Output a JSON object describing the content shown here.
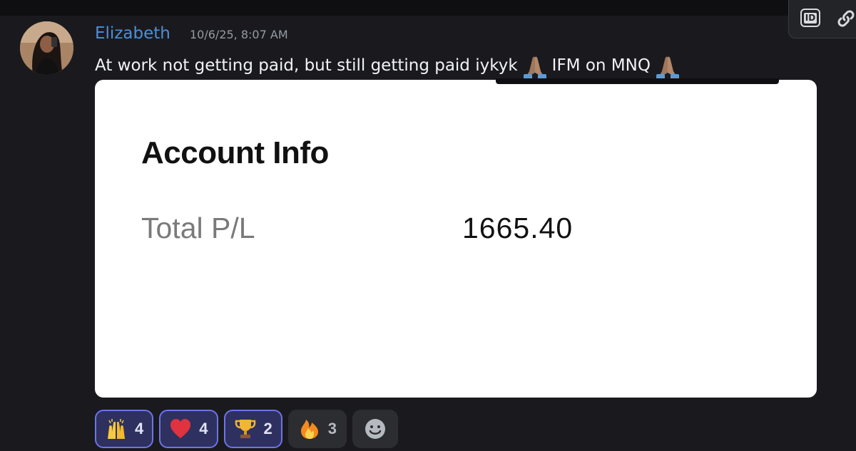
{
  "message": {
    "username": "Elizabeth",
    "timestamp": "10/6/25, 8:07 AM",
    "text_part1": "At work not getting paid, but still getting paid iykyk",
    "text_part2": "IFM on MNQ"
  },
  "embed": {
    "title": "Account Info",
    "pl_label": "Total P/L",
    "pl_value": "1665.40"
  },
  "reactions": [
    {
      "emoji": "raising-hands-icon",
      "count": "4",
      "selected": true
    },
    {
      "emoji": "red-heart-icon",
      "count": "4",
      "selected": true
    },
    {
      "emoji": "trophy-icon",
      "count": "2",
      "selected": true
    },
    {
      "emoji": "fire-icon",
      "count": "3",
      "selected": false
    }
  ],
  "toolbar": {
    "icons": [
      "id-icon",
      "link-icon"
    ]
  },
  "colors": {
    "background": "#1a1a1e",
    "username": "#4e8fd6",
    "selected_reaction_border": "#6d74e8",
    "selected_reaction_bg": "#2e3160"
  }
}
